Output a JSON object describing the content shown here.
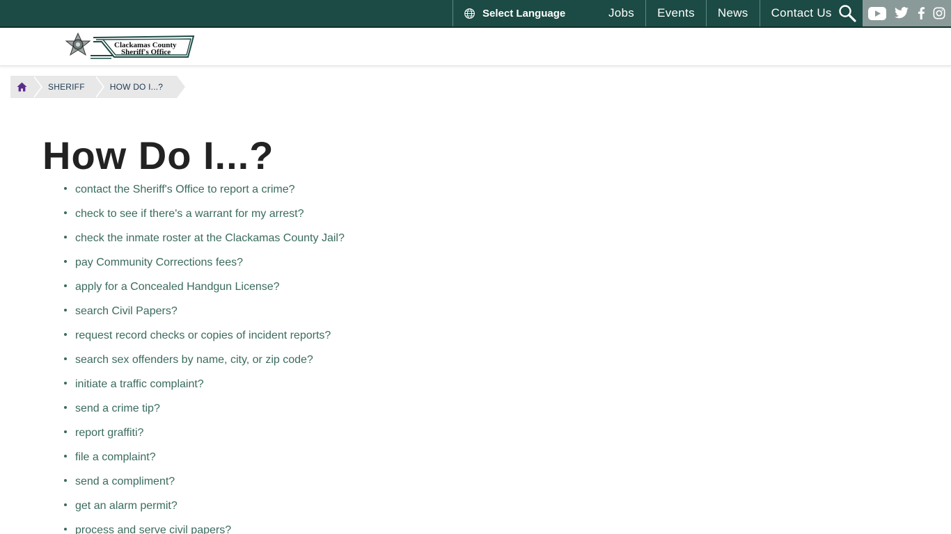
{
  "topbar": {
    "language_label": "Select Language",
    "nav": [
      "Jobs",
      "Events",
      "News",
      "Contact Us"
    ]
  },
  "logo": {
    "line1": "Clackamas County",
    "line2": "Sheriff's Office"
  },
  "breadcrumb": {
    "items": [
      "SHERIFF",
      "HOW DO I...?"
    ]
  },
  "page": {
    "title": "How Do I...?"
  },
  "links": [
    "contact the Sheriff's Office to report a crime?",
    "check to see if there's a warrant for my arrest?",
    "check the inmate roster at the Clackamas County Jail?",
    "pay Community Corrections fees?",
    "apply for a Concealed Handgun License?",
    "search Civil Papers?",
    "request record checks or copies of incident reports?",
    "search sex offenders by name, city, or zip code?",
    "initiate a traffic complaint?",
    "send a crime tip?",
    "report graffiti?",
    "file a complaint?",
    "send a compliment?",
    "get an alarm permit?",
    "process and serve civil papers?"
  ],
  "colors": {
    "topbar": "#1c4a44",
    "link": "#3a6b5e",
    "home_icon": "#5a2d8c"
  }
}
